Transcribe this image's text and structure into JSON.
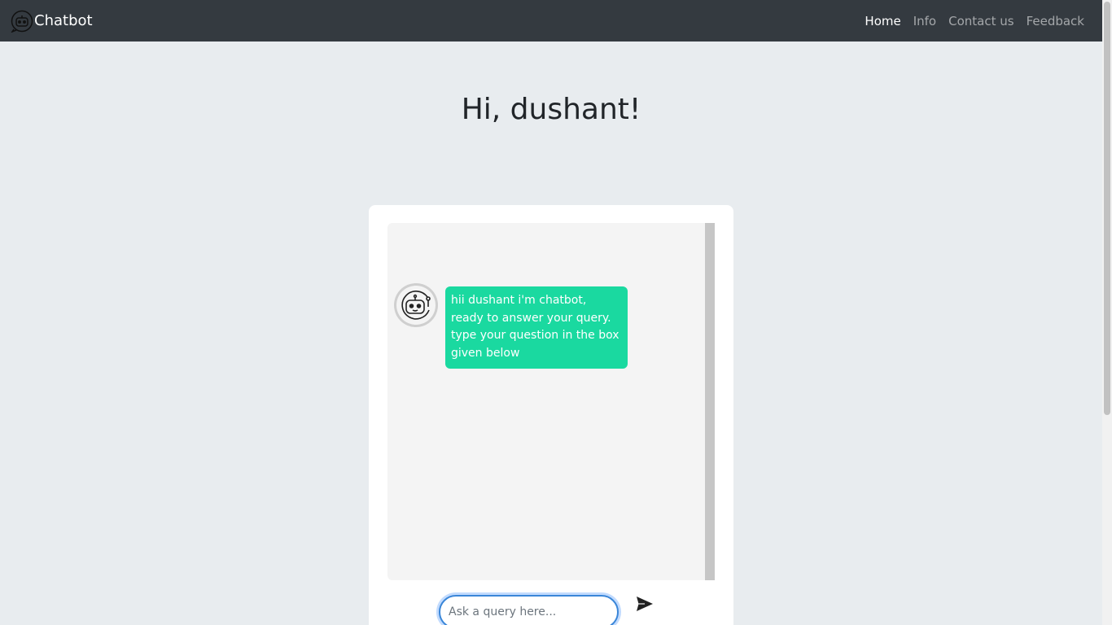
{
  "navbar": {
    "brand": "Chatbot",
    "links": [
      {
        "label": "Home",
        "active": true
      },
      {
        "label": "Info",
        "active": false
      },
      {
        "label": "Contact us",
        "active": false
      },
      {
        "label": "Feedback",
        "active": false
      }
    ]
  },
  "greeting": "Hi, dushant!",
  "chat": {
    "messages": [
      {
        "sender": "bot",
        "text": "hii dushant i'm chatbot, ready to answer your query. type your question in the box given below"
      }
    ]
  },
  "input": {
    "value": "",
    "placeholder": "Ask a query here..."
  },
  "icons": {
    "brand": "chatbot-icon",
    "avatar": "robot-icon",
    "send": "send-icon"
  },
  "colors": {
    "navbar_bg": "#343a40",
    "page_bg": "#e8ecef",
    "bubble_bg": "#1ad9a0",
    "input_border": "#3a86d8"
  }
}
